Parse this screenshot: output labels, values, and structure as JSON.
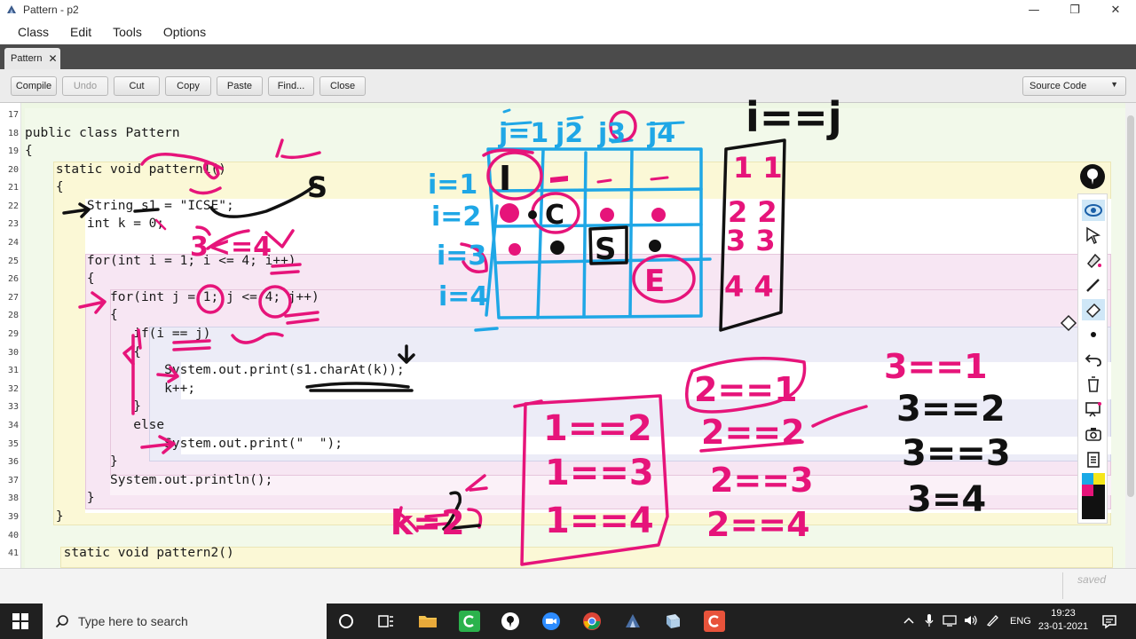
{
  "window": {
    "title": "Pattern - p2",
    "minimize_glyph": "—",
    "maximize_glyph": "❐",
    "close_glyph": "✕"
  },
  "menu": [
    {
      "label": "Class"
    },
    {
      "label": "Edit"
    },
    {
      "label": "Tools"
    },
    {
      "label": "Options"
    }
  ],
  "tabs": [
    {
      "label": "Pattern",
      "close_glyph": "✕"
    }
  ],
  "toolbar": {
    "compile": "Compile",
    "undo": "Undo",
    "cut": "Cut",
    "copy": "Copy",
    "paste": "Paste",
    "find": "Find...",
    "close": "Close",
    "view_select": "Source Code"
  },
  "editor": {
    "line_numbers": [
      "17",
      "18",
      "19",
      "20",
      "21",
      "22",
      "23",
      "24",
      "25",
      "26",
      "27",
      "28",
      "29",
      "30",
      "31",
      "32",
      "33",
      "34",
      "35",
      "36",
      "37",
      "38",
      "39",
      "40",
      "41"
    ],
    "lines": [
      "",
      "public class Pattern",
      "{",
      "    static void pattern1()",
      "    {",
      "        String s1 = \"ICSE\";",
      "        int k = 0;",
      "",
      "        for(int i = 1; i <= 4; i++)",
      "        {",
      "           for(int j = 1; j <= 4; j++)",
      "           {",
      "              if(i == j)",
      "              {",
      "                  System.out.print(s1.charAt(k));",
      "                  k++;",
      "              }",
      "              else",
      "                  System.out.print(\"  \");",
      "           }",
      "           System.out.println();",
      "        }",
      "    }",
      "",
      "     static void pattern2()"
    ]
  },
  "annotations": {
    "header_cols": [
      "j=1",
      "j2",
      "j3",
      "j4"
    ],
    "row_labels": [
      "i=1",
      "i=2",
      "i=3",
      "i=4"
    ],
    "grid_letters": [
      "I",
      "C",
      "S",
      "E"
    ],
    "condition_title": "i==j",
    "pairs": [
      "1 1",
      "2 2",
      "3 3",
      "4 4"
    ],
    "comparisons_i1": [
      "1==2",
      "1==3",
      "1==4"
    ],
    "comparisons_i2": [
      "2==1",
      "2==2",
      "2==3",
      "2==4"
    ],
    "comparisons_i3": [
      "3==1",
      "3==2",
      "3==3",
      "3=4"
    ],
    "k_note": "k=2",
    "cond_note": "3<=4",
    "s_note": "S"
  },
  "status": {
    "saved": "saved"
  },
  "taskbar": {
    "search_placeholder": "Type here to search",
    "lang": "ENG",
    "time": "19:23",
    "date": "23-01-2021"
  },
  "colors": {
    "ink_blue": "#1fa7e6",
    "ink_pink": "#e6147a",
    "ink_black": "#111111",
    "block_yellow": "#fbf8d6",
    "block_pink": "#f7e6f3",
    "block_lavender": "#ececf7",
    "taskbar": "#202020",
    "tabstrip": "#4b4b4b"
  }
}
